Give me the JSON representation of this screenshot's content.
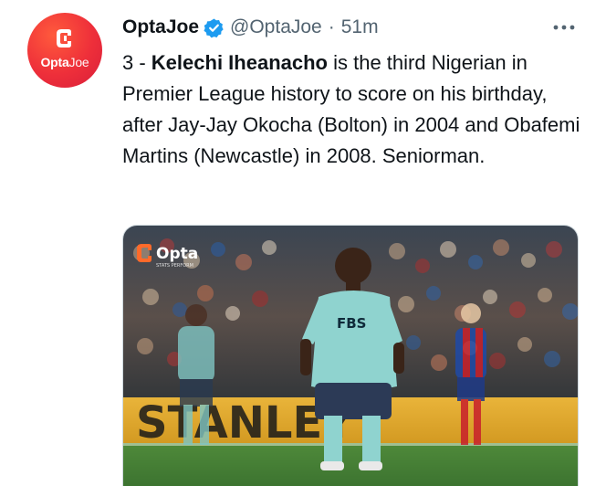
{
  "author": {
    "avatar_brand_bold": "Opta",
    "avatar_brand_light": "Joe",
    "display_name": "OptaJoe",
    "handle": "@OptaJoe",
    "separator": "·",
    "timestamp": "51m"
  },
  "tweet": {
    "prefix": "3 - ",
    "highlight": "Kelechi Iheanacho",
    "body": " is the third Nigerian in Premier League history to score on his birthday, after Jay-Jay Okocha (Bolton) in 2004 and Obafemi Martins (Newcastle) in 2008. Seniorman."
  },
  "media": {
    "watermark": "Opta",
    "watermark_sub": "STATS PERFORM",
    "shirt_sponsor": "FBS",
    "board_text": "STANLEY",
    "description_icon": "football-photo"
  },
  "colors": {
    "avatar": "#ee2f3a",
    "verified": "#1d9bf0",
    "muted": "#536471",
    "text": "#0f1419"
  }
}
